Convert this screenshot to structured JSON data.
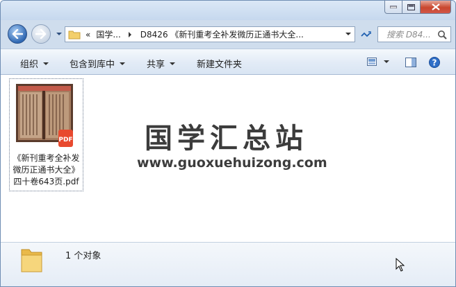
{
  "address_bar": {
    "overflow": "«",
    "crumb1": "国学...",
    "crumb2": "D8426 《新刊重考全补发微历正通书大全..."
  },
  "search": {
    "placeholder": "搜索 D84..."
  },
  "toolbar": {
    "organize": "组织",
    "include_in_library": "包含到库中",
    "share": "共享",
    "new_folder": "新建文件夹"
  },
  "file": {
    "name_line1": "《新刊重考全补发",
    "name_line2": "微历正通书大全》",
    "name_line3": "四十卷643页.pdf",
    "badge": "PDF"
  },
  "watermark": {
    "title": "国学汇总站",
    "url": "www.guoxuehuizong.com"
  },
  "status": {
    "item_count": "1 个对象"
  },
  "colors": {
    "accent": "#2f68b3",
    "close": "#c9472e",
    "pdf_badge": "#e8492e"
  }
}
